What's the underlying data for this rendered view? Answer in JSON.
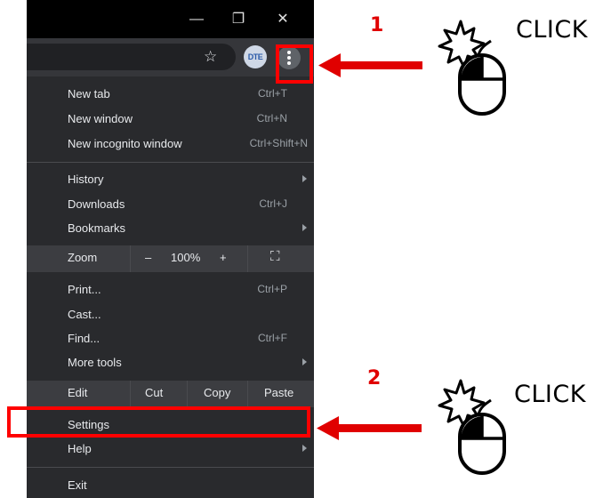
{
  "window": {
    "minimize_glyph": "—",
    "restore_glyph": "❐",
    "close_glyph": "✕"
  },
  "toolbar": {
    "star_glyph": "☆",
    "profile_text": "DTE",
    "icons": [
      "star-icon",
      "profile-avatar",
      "more-vertical-icon"
    ]
  },
  "menu": {
    "items": [
      {
        "label": "New tab",
        "accel": "Ctrl+T"
      },
      {
        "label": "New window",
        "accel": "Ctrl+N"
      },
      {
        "label": "New incognito window",
        "accel": "Ctrl+Shift+N"
      },
      {
        "label": "History",
        "accel": ""
      },
      {
        "label": "Downloads",
        "accel": "Ctrl+J"
      },
      {
        "label": "Bookmarks",
        "accel": ""
      },
      {
        "label": "Print...",
        "accel": "Ctrl+P"
      },
      {
        "label": "Cast...",
        "accel": ""
      },
      {
        "label": "Find...",
        "accel": "Ctrl+F"
      },
      {
        "label": "More tools",
        "accel": ""
      },
      {
        "label": "Settings",
        "accel": ""
      },
      {
        "label": "Help",
        "accel": ""
      },
      {
        "label": "Exit",
        "accel": ""
      }
    ],
    "zoom": {
      "label": "Zoom",
      "minus": "–",
      "value": "100%",
      "plus": "+",
      "fullscreen_glyph": "⛶"
    },
    "edit": {
      "label": "Edit",
      "cut": "Cut",
      "copy": "Copy",
      "paste": "Paste"
    }
  },
  "annotations": {
    "step1_number": "1",
    "step2_number": "2",
    "click_text": "CLICK",
    "highlight_color": "#ff0000"
  }
}
